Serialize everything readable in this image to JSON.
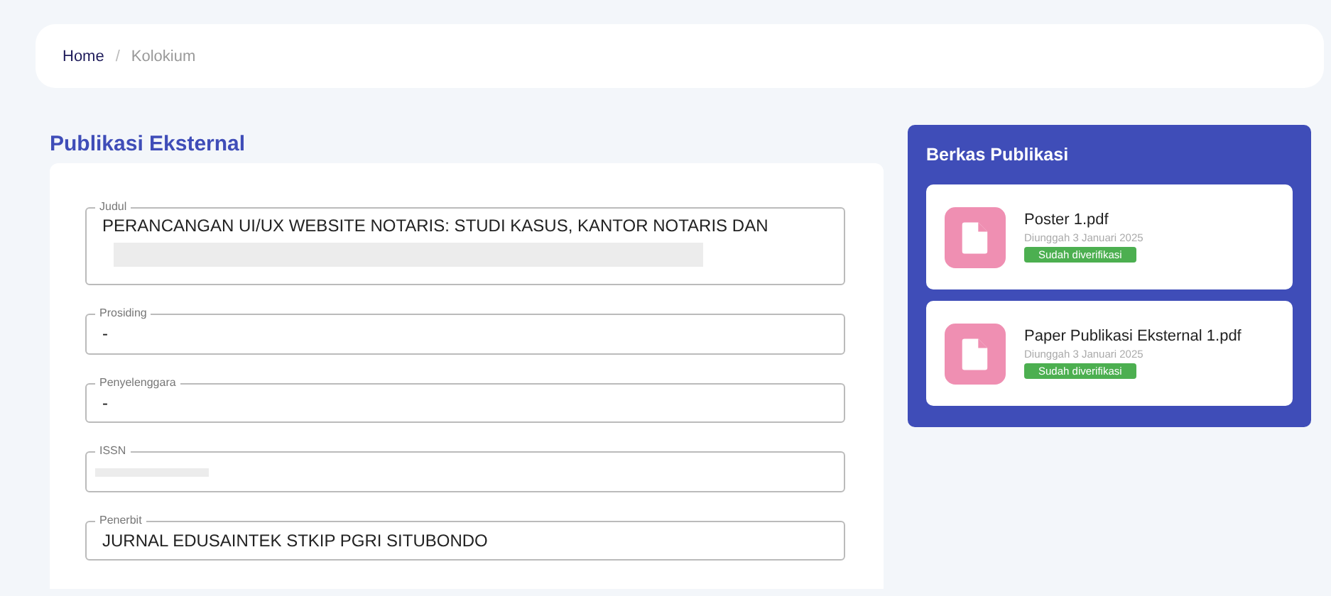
{
  "breadcrumb": [
    {
      "label": "Home",
      "selected": false
    },
    {
      "label": "Kolokium",
      "selected": true
    }
  ],
  "breadcrumb_separator": "/",
  "section_title": "Publikasi Eksternal",
  "fields": [
    {
      "label": "Judul",
      "value": "PERANCANGAN UI/UX WEBSITE NOTARIS: STUDI KASUS, KANTOR NOTARIS DAN",
      "redacted": true
    },
    {
      "label": "Prosiding",
      "value": "-",
      "redacted": false
    },
    {
      "label": "Penyelenggara",
      "value": "-",
      "redacted": false
    },
    {
      "label": "ISSN",
      "redacted": true
    },
    {
      "label": "Penerbit",
      "value": "JURNAL EDUSAINTEK STKIP PGRI SITUBONDO",
      "redacted": false
    }
  ],
  "files_panel": {
    "title": "Berkas Publikasi",
    "files": [
      {
        "name": "Poster 1.pdf",
        "uploaded": "Diunggah 3 Januari 2025",
        "status": "Sudah diverifikasi",
        "verified": true
      },
      {
        "name": "Paper Publikasi Eksternal 1.pdf",
        "uploaded": "Diunggah 3 Januari 2025",
        "status": "Sudah diverifikasi",
        "verified": true
      }
    ]
  }
}
